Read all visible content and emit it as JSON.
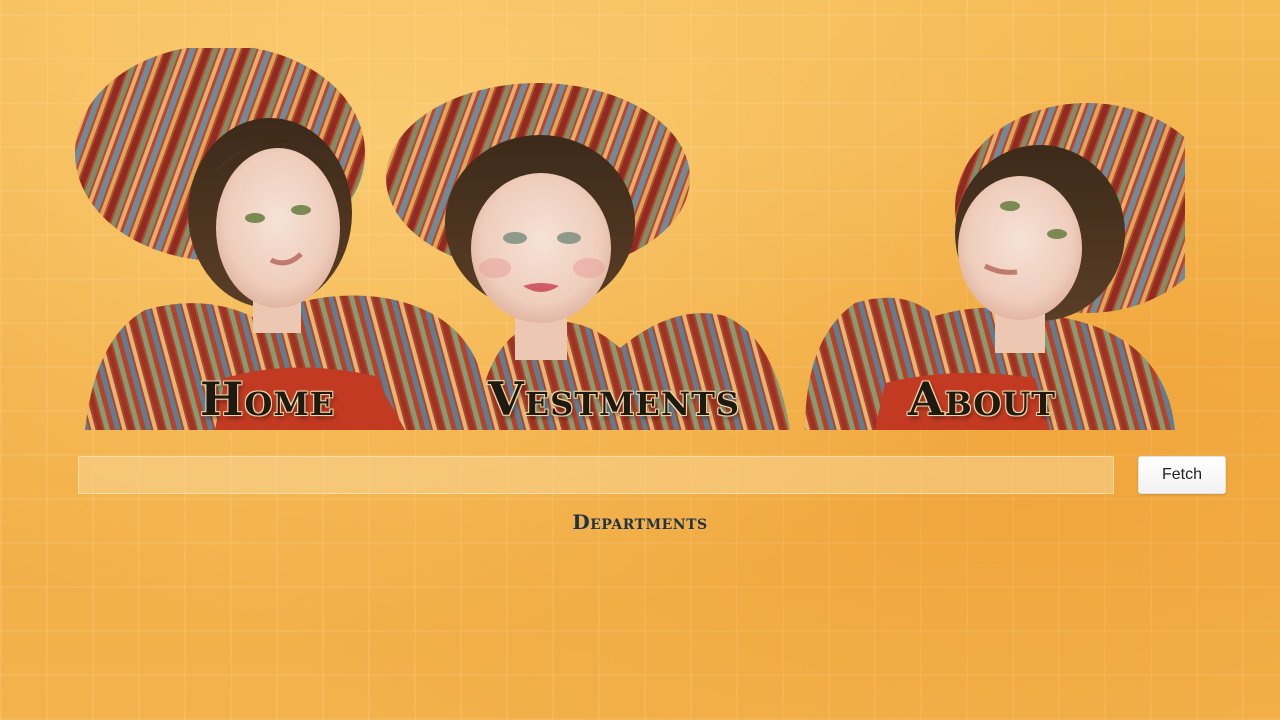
{
  "nav": {
    "items": [
      {
        "label": "Home"
      },
      {
        "label": "Vestments"
      },
      {
        "label": "About"
      }
    ]
  },
  "search": {
    "value": "",
    "placeholder": ""
  },
  "fetch_button": {
    "label": "Fetch"
  },
  "departments_heading": "Departments",
  "banner": {
    "description_icon": "three-figures-banner-image"
  },
  "colors": {
    "page_background": "#f3b24a",
    "nav_text": "#1d1a12",
    "heading_text": "#1e3346"
  }
}
